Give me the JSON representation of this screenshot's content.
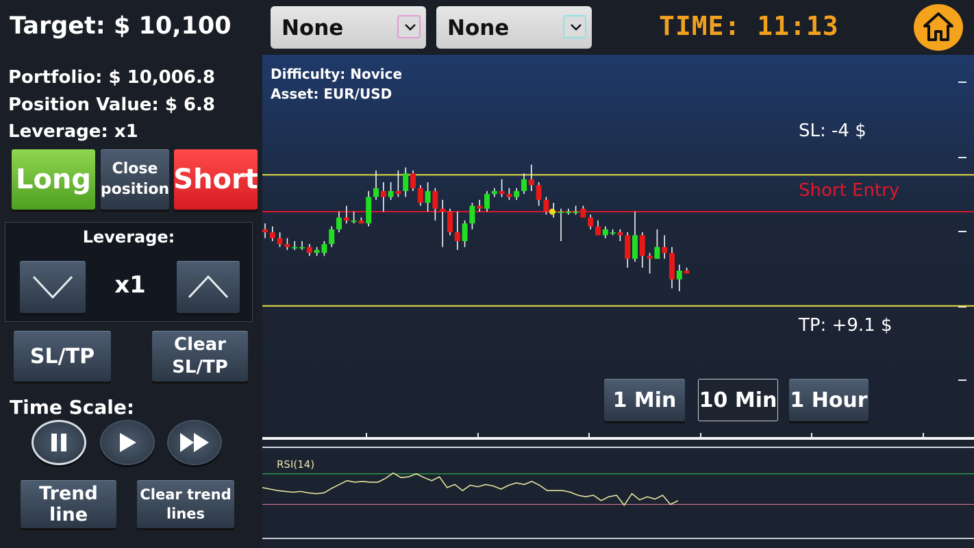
{
  "header": {
    "target_label": "Target:  $ 10,100",
    "dropdown_1": "None",
    "dropdown_2": "None",
    "time_label": "TIME: 11:13"
  },
  "stats": {
    "portfolio": "Portfolio:  $ 10,006.8",
    "position_value": "Position Value:  $ 6.8",
    "leverage": "Leverage: x1"
  },
  "actions": {
    "long": "Long",
    "close_line1": "Close",
    "close_line2": "position",
    "short": "Short"
  },
  "leverage_control": {
    "title": "Leverage:",
    "value": "x1"
  },
  "tools": {
    "sltp": "SL/TP",
    "clear_line1": "Clear",
    "clear_line2": "SL/TP",
    "time_scale": "Time Scale:",
    "trend_line": "Trend line",
    "clear_trend_line1": "Clear trend",
    "clear_trend_line2": "lines"
  },
  "chart": {
    "difficulty": "Difficulty: Novice",
    "asset": "Asset: EUR/USD",
    "sl_label": "SL: -4 $",
    "entry_label": "Short Entry",
    "tp_label": "TP: +9.1 $",
    "timeframes": [
      "1 Min",
      "10 Min",
      "1 Hour"
    ],
    "selected_timeframe": "10 Min",
    "rsi_label": "RSI(14)"
  },
  "colors": {
    "bull": "#22dd22",
    "bear": "#e81818",
    "sl_tp_line": "#e8e040",
    "entry_line": "#d8182a",
    "accent": "#f2a11f"
  },
  "chart_data": {
    "type": "candlestick",
    "ylim": [
      0,
      100
    ],
    "levels": {
      "sl": 82.5,
      "short_entry": 70,
      "tp": 38
    },
    "candles": [
      {
        "o": 64,
        "h": 66,
        "l": 61,
        "c": 63
      },
      {
        "o": 63,
        "h": 65,
        "l": 60,
        "c": 61
      },
      {
        "o": 61,
        "h": 63,
        "l": 58,
        "c": 59
      },
      {
        "o": 59,
        "h": 61,
        "l": 57,
        "c": 58
      },
      {
        "o": 58,
        "h": 60,
        "l": 57,
        "c": 58
      },
      {
        "o": 58,
        "h": 60,
        "l": 57,
        "c": 58
      },
      {
        "o": 58,
        "h": 59,
        "l": 55,
        "c": 56
      },
      {
        "o": 56,
        "h": 58,
        "l": 55,
        "c": 57
      },
      {
        "o": 56,
        "h": 60,
        "l": 55,
        "c": 59
      },
      {
        "o": 59,
        "h": 65,
        "l": 58,
        "c": 64
      },
      {
        "o": 64,
        "h": 70,
        "l": 63,
        "c": 68
      },
      {
        "o": 68,
        "h": 72,
        "l": 66,
        "c": 67
      },
      {
        "o": 67,
        "h": 70,
        "l": 66,
        "c": 67
      },
      {
        "o": 67,
        "h": 68,
        "l": 66,
        "c": 66
      },
      {
        "o": 66,
        "h": 77,
        "l": 65,
        "c": 75
      },
      {
        "o": 75,
        "h": 84,
        "l": 74,
        "c": 78
      },
      {
        "o": 77,
        "h": 80,
        "l": 70,
        "c": 75
      },
      {
        "o": 75,
        "h": 80,
        "l": 74,
        "c": 77
      },
      {
        "o": 77,
        "h": 84,
        "l": 75,
        "c": 76
      },
      {
        "o": 77,
        "h": 85,
        "l": 75,
        "c": 83
      },
      {
        "o": 83,
        "h": 84,
        "l": 77,
        "c": 78
      },
      {
        "o": 78,
        "h": 79,
        "l": 72,
        "c": 73
      },
      {
        "o": 73,
        "h": 80,
        "l": 70,
        "c": 77
      },
      {
        "o": 77,
        "h": 78,
        "l": 67,
        "c": 71
      },
      {
        "o": 71,
        "h": 74,
        "l": 58,
        "c": 70
      },
      {
        "o": 70,
        "h": 71,
        "l": 62,
        "c": 63
      },
      {
        "o": 63,
        "h": 70,
        "l": 57,
        "c": 60
      },
      {
        "o": 60,
        "h": 67,
        "l": 58,
        "c": 66
      },
      {
        "o": 66,
        "h": 73,
        "l": 64,
        "c": 72
      },
      {
        "o": 72,
        "h": 74,
        "l": 70,
        "c": 71
      },
      {
        "o": 71,
        "h": 77,
        "l": 70,
        "c": 76
      },
      {
        "o": 76,
        "h": 78,
        "l": 75,
        "c": 77
      },
      {
        "o": 77,
        "h": 81,
        "l": 75,
        "c": 76
      },
      {
        "o": 76,
        "h": 78,
        "l": 74,
        "c": 75
      },
      {
        "o": 75,
        "h": 78,
        "l": 74,
        "c": 77
      },
      {
        "o": 77,
        "h": 83,
        "l": 76,
        "c": 81
      },
      {
        "o": 81,
        "h": 86,
        "l": 77,
        "c": 79
      },
      {
        "o": 79,
        "h": 80,
        "l": 72,
        "c": 74
      },
      {
        "o": 74,
        "h": 75,
        "l": 69,
        "c": 70
      },
      {
        "o": 70,
        "h": 73,
        "l": 68,
        "c": 70
      },
      {
        "o": 70,
        "h": 71,
        "l": 60,
        "c": 70
      },
      {
        "o": 70,
        "h": 71,
        "l": 69,
        "c": 70
      },
      {
        "o": 70,
        "h": 72,
        "l": 69,
        "c": 70
      },
      {
        "o": 71,
        "h": 72,
        "l": 68,
        "c": 68
      },
      {
        "o": 68,
        "h": 69,
        "l": 64,
        "c": 65
      },
      {
        "o": 65,
        "h": 67,
        "l": 62,
        "c": 62
      },
      {
        "o": 62,
        "h": 65,
        "l": 61,
        "c": 64
      },
      {
        "o": 63,
        "h": 64,
        "l": 62,
        "c": 63
      },
      {
        "o": 63,
        "h": 64,
        "l": 60,
        "c": 62
      },
      {
        "o": 62,
        "h": 63,
        "l": 51,
        "c": 54
      },
      {
        "o": 54,
        "h": 70,
        "l": 53,
        "c": 62
      },
      {
        "o": 62,
        "h": 63,
        "l": 51,
        "c": 55
      },
      {
        "o": 55,
        "h": 56,
        "l": 49,
        "c": 54
      },
      {
        "o": 54,
        "h": 64,
        "l": 54,
        "c": 58
      },
      {
        "o": 58,
        "h": 62,
        "l": 54,
        "c": 56
      },
      {
        "o": 56,
        "h": 58,
        "l": 44,
        "c": 47
      },
      {
        "o": 47,
        "h": 52,
        "l": 43,
        "c": 50
      },
      {
        "o": 50,
        "h": 51,
        "l": 49,
        "c": 49
      }
    ],
    "rsi": {
      "label": "RSI(14)",
      "upper": 70,
      "lower": 30,
      "values": [
        52,
        50,
        48,
        47,
        46,
        47,
        45,
        44,
        45,
        51,
        56,
        61,
        59,
        60,
        59,
        59,
        64,
        71,
        65,
        66,
        70,
        65,
        61,
        66,
        52,
        56,
        48,
        55,
        53,
        56,
        54,
        50,
        55,
        58,
        56,
        60,
        55,
        48,
        48,
        48,
        46,
        42,
        40,
        42,
        35,
        40,
        42,
        29,
        44,
        36,
        40,
        37,
        42,
        30,
        35
      ]
    }
  }
}
